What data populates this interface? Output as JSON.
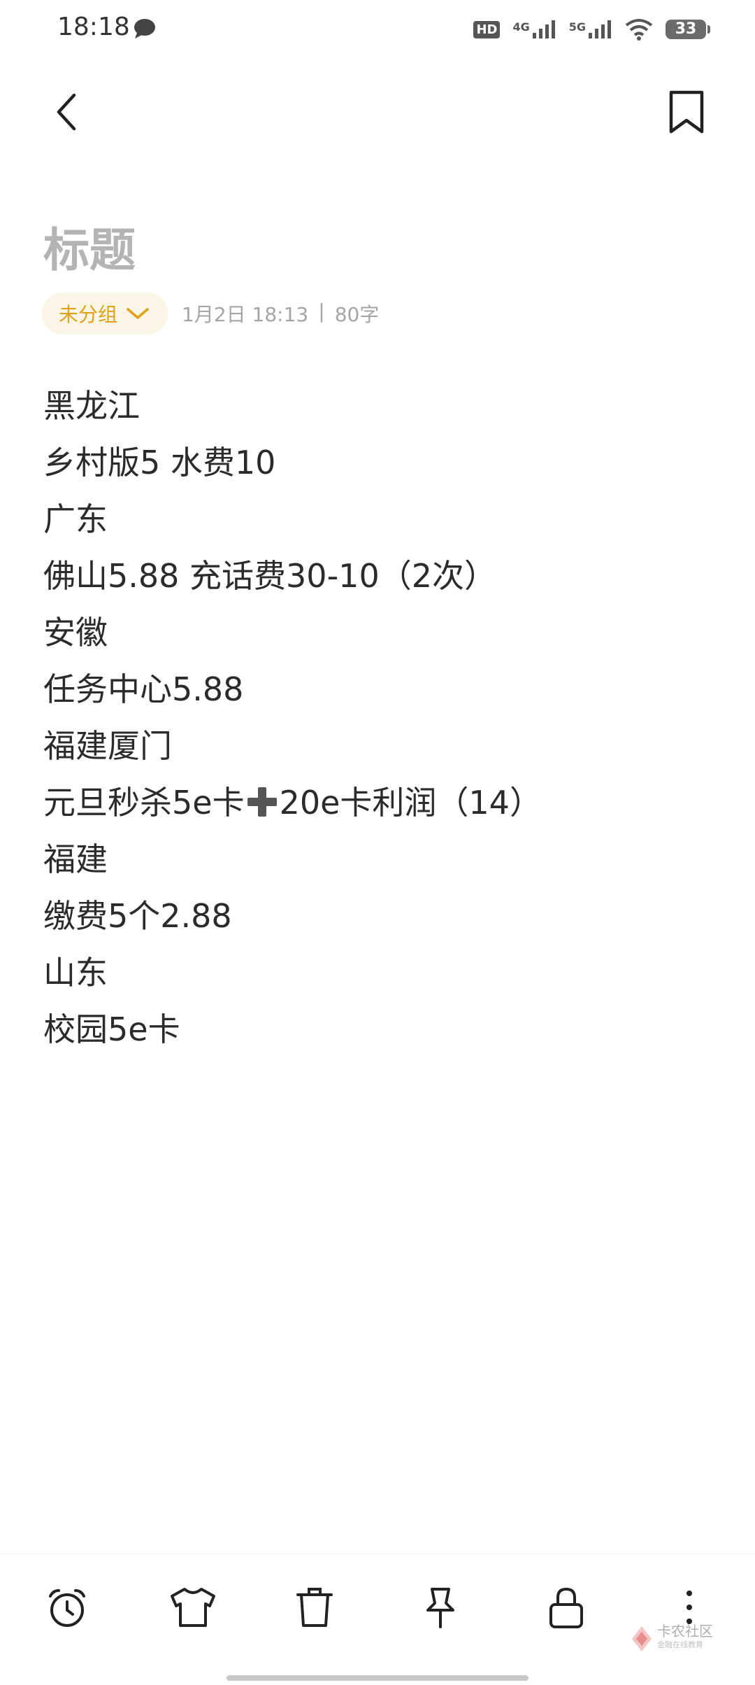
{
  "status_bar": {
    "time": "18:18",
    "hd_label": "HD",
    "network_1": "4G",
    "network_2": "5G",
    "battery": "33"
  },
  "note": {
    "title": "标题",
    "group": "未分组",
    "date": "1月2日 18:13",
    "separator": "|",
    "word_count": "80字",
    "lines": [
      "黑龙江",
      "乡村版5  水费10",
      "广东",
      "佛山5.88  充话费30-10（2次）",
      "安徽",
      "任务中心5.88",
      "福建厦门",
      "元旦秒杀5e卡",
      "20e卡利润（14）",
      "福建",
      "缴费5个2.88",
      "山东",
      "校园5e卡"
    ]
  },
  "watermark": {
    "name": "卡农社区",
    "sub": "金融在线教育"
  },
  "colors": {
    "accent": "#e0a11b",
    "chip_bg": "#fbf5e6",
    "title_placeholder": "#b4b4b4",
    "body_text": "#2b2b2b",
    "meta_text": "#a5a5a5"
  },
  "icons": [
    "message-icon",
    "signal-icon",
    "wifi-icon",
    "battery-icon",
    "back-arrow-icon",
    "bookmark-icon",
    "alarm-clock-icon",
    "shirt-icon",
    "trash-icon",
    "pin-icon",
    "lock-icon",
    "more-vertical-icon"
  ]
}
